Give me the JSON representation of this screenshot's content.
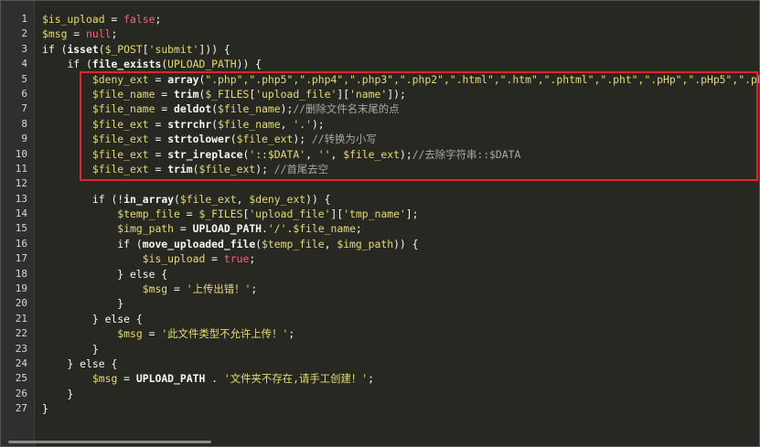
{
  "editor": {
    "line_numbers": [
      "1",
      "2",
      "3",
      "4",
      "5",
      "6",
      "7",
      "8",
      "9",
      "10",
      "11",
      "12",
      "13",
      "14",
      "15",
      "16",
      "17",
      "18",
      "19",
      "20",
      "21",
      "22",
      "23",
      "24",
      "25",
      "26",
      "27"
    ],
    "lines": [
      [
        {
          "t": "v",
          "x": "$is_upload"
        },
        {
          "t": "p",
          "x": " = "
        },
        {
          "t": "n",
          "x": "false"
        },
        {
          "t": "p",
          "x": ";"
        }
      ],
      [
        {
          "t": "v",
          "x": "$msg"
        },
        {
          "t": "p",
          "x": " = "
        },
        {
          "t": "n",
          "x": "null"
        },
        {
          "t": "p",
          "x": ";"
        }
      ],
      [
        {
          "t": "k",
          "x": "if"
        },
        {
          "t": "p",
          "x": " ("
        },
        {
          "t": "f",
          "x": "isset"
        },
        {
          "t": "p",
          "x": "("
        },
        {
          "t": "v",
          "x": "$_POST"
        },
        {
          "t": "p",
          "x": "["
        },
        {
          "t": "s",
          "x": "'submit'"
        },
        {
          "t": "p",
          "x": "])) {"
        }
      ],
      [
        {
          "t": "p",
          "x": "    "
        },
        {
          "t": "k",
          "x": "if"
        },
        {
          "t": "p",
          "x": " ("
        },
        {
          "t": "f",
          "x": "file_exists"
        },
        {
          "t": "p",
          "x": "("
        },
        {
          "t": "v",
          "x": "UPLOAD_PATH"
        },
        {
          "t": "p",
          "x": ")) {"
        }
      ],
      [
        {
          "t": "p",
          "x": "        "
        },
        {
          "t": "v",
          "x": "$deny_ext"
        },
        {
          "t": "p",
          "x": " = "
        },
        {
          "t": "f",
          "x": "array"
        },
        {
          "t": "p",
          "x": "("
        },
        {
          "t": "s",
          "x": "\".php\",\".php5\",\".php4\",\".php3\",\".php2\",\".html\",\".htm\",\".phtml\",\".pht\",\".pHp\",\".pHp5\",\".pHp4\",\".pHp3\",\".p"
        }
      ],
      [
        {
          "t": "p",
          "x": "        "
        },
        {
          "t": "v",
          "x": "$file_name"
        },
        {
          "t": "p",
          "x": " = "
        },
        {
          "t": "f",
          "x": "trim"
        },
        {
          "t": "p",
          "x": "("
        },
        {
          "t": "v",
          "x": "$_FILES"
        },
        {
          "t": "p",
          "x": "["
        },
        {
          "t": "s",
          "x": "'upload_file'"
        },
        {
          "t": "p",
          "x": "]["
        },
        {
          "t": "s",
          "x": "'name'"
        },
        {
          "t": "p",
          "x": "]);"
        }
      ],
      [
        {
          "t": "p",
          "x": "        "
        },
        {
          "t": "v",
          "x": "$file_name"
        },
        {
          "t": "p",
          "x": " = "
        },
        {
          "t": "f",
          "x": "deldot"
        },
        {
          "t": "p",
          "x": "("
        },
        {
          "t": "v",
          "x": "$file_name"
        },
        {
          "t": "p",
          "x": ");"
        },
        {
          "t": "c",
          "x": "//删除文件名末尾的点"
        }
      ],
      [
        {
          "t": "p",
          "x": "        "
        },
        {
          "t": "v",
          "x": "$file_ext"
        },
        {
          "t": "p",
          "x": " = "
        },
        {
          "t": "f",
          "x": "strrchr"
        },
        {
          "t": "p",
          "x": "("
        },
        {
          "t": "v",
          "x": "$file_name"
        },
        {
          "t": "p",
          "x": ", "
        },
        {
          "t": "s",
          "x": "'.'"
        },
        {
          "t": "p",
          "x": ");"
        }
      ],
      [
        {
          "t": "p",
          "x": "        "
        },
        {
          "t": "v",
          "x": "$file_ext"
        },
        {
          "t": "p",
          "x": " = "
        },
        {
          "t": "f",
          "x": "strtolower"
        },
        {
          "t": "p",
          "x": "("
        },
        {
          "t": "v",
          "x": "$file_ext"
        },
        {
          "t": "p",
          "x": "); "
        },
        {
          "t": "c",
          "x": "//转换为小写"
        }
      ],
      [
        {
          "t": "p",
          "x": "        "
        },
        {
          "t": "v",
          "x": "$file_ext"
        },
        {
          "t": "p",
          "x": " = "
        },
        {
          "t": "f",
          "x": "str_ireplace"
        },
        {
          "t": "p",
          "x": "("
        },
        {
          "t": "s",
          "x": "'::$DATA'"
        },
        {
          "t": "p",
          "x": ", "
        },
        {
          "t": "s",
          "x": "''"
        },
        {
          "t": "p",
          "x": ", "
        },
        {
          "t": "v",
          "x": "$file_ext"
        },
        {
          "t": "p",
          "x": ");"
        },
        {
          "t": "c",
          "x": "//去除字符串::$DATA"
        }
      ],
      [
        {
          "t": "p",
          "x": "        "
        },
        {
          "t": "v",
          "x": "$file_ext"
        },
        {
          "t": "p",
          "x": " = "
        },
        {
          "t": "f",
          "x": "trim"
        },
        {
          "t": "p",
          "x": "("
        },
        {
          "t": "v",
          "x": "$file_ext"
        },
        {
          "t": "p",
          "x": "); "
        },
        {
          "t": "c",
          "x": "//首尾去空"
        }
      ],
      [],
      [
        {
          "t": "p",
          "x": "        "
        },
        {
          "t": "k",
          "x": "if"
        },
        {
          "t": "p",
          "x": " (!"
        },
        {
          "t": "f",
          "x": "in_array"
        },
        {
          "t": "p",
          "x": "("
        },
        {
          "t": "v",
          "x": "$file_ext"
        },
        {
          "t": "p",
          "x": ", "
        },
        {
          "t": "v",
          "x": "$deny_ext"
        },
        {
          "t": "p",
          "x": ")) {"
        }
      ],
      [
        {
          "t": "p",
          "x": "            "
        },
        {
          "t": "v",
          "x": "$temp_file"
        },
        {
          "t": "p",
          "x": " = "
        },
        {
          "t": "v",
          "x": "$_FILES"
        },
        {
          "t": "p",
          "x": "["
        },
        {
          "t": "s",
          "x": "'upload_file'"
        },
        {
          "t": "p",
          "x": "]["
        },
        {
          "t": "s",
          "x": "'tmp_name'"
        },
        {
          "t": "p",
          "x": "];"
        }
      ],
      [
        {
          "t": "p",
          "x": "            "
        },
        {
          "t": "v",
          "x": "$img_path"
        },
        {
          "t": "p",
          "x": " = "
        },
        {
          "t": "f",
          "x": "UPLOAD_PATH"
        },
        {
          "t": "p",
          "x": "."
        },
        {
          "t": "s",
          "x": "'/'"
        },
        {
          "t": "p",
          "x": "."
        },
        {
          "t": "v",
          "x": "$file_name"
        },
        {
          "t": "p",
          "x": ";"
        }
      ],
      [
        {
          "t": "p",
          "x": "            "
        },
        {
          "t": "k",
          "x": "if"
        },
        {
          "t": "p",
          "x": " ("
        },
        {
          "t": "f",
          "x": "move_uploaded_file"
        },
        {
          "t": "p",
          "x": "("
        },
        {
          "t": "v",
          "x": "$temp_file"
        },
        {
          "t": "p",
          "x": ", "
        },
        {
          "t": "v",
          "x": "$img_path"
        },
        {
          "t": "p",
          "x": ")) {"
        }
      ],
      [
        {
          "t": "p",
          "x": "                "
        },
        {
          "t": "v",
          "x": "$is_upload"
        },
        {
          "t": "p",
          "x": " = "
        },
        {
          "t": "n",
          "x": "true"
        },
        {
          "t": "p",
          "x": ";"
        }
      ],
      [
        {
          "t": "p",
          "x": "            } "
        },
        {
          "t": "k",
          "x": "else"
        },
        {
          "t": "p",
          "x": " {"
        }
      ],
      [
        {
          "t": "p",
          "x": "                "
        },
        {
          "t": "v",
          "x": "$msg"
        },
        {
          "t": "p",
          "x": " = "
        },
        {
          "t": "s",
          "x": "'上传出错！'"
        },
        {
          "t": "p",
          "x": ";"
        }
      ],
      [
        {
          "t": "p",
          "x": "            }"
        }
      ],
      [
        {
          "t": "p",
          "x": "        } "
        },
        {
          "t": "k",
          "x": "else"
        },
        {
          "t": "p",
          "x": " {"
        }
      ],
      [
        {
          "t": "p",
          "x": "            "
        },
        {
          "t": "v",
          "x": "$msg"
        },
        {
          "t": "p",
          "x": " = "
        },
        {
          "t": "s",
          "x": "'此文件类型不允许上传！'"
        },
        {
          "t": "p",
          "x": ";"
        }
      ],
      [
        {
          "t": "p",
          "x": "        }"
        }
      ],
      [
        {
          "t": "p",
          "x": "    } "
        },
        {
          "t": "k",
          "x": "else"
        },
        {
          "t": "p",
          "x": " {"
        }
      ],
      [
        {
          "t": "p",
          "x": "        "
        },
        {
          "t": "v",
          "x": "$msg"
        },
        {
          "t": "p",
          "x": " = "
        },
        {
          "t": "f",
          "x": "UPLOAD_PATH"
        },
        {
          "t": "p",
          "x": " . "
        },
        {
          "t": "s",
          "x": "'文件夹不存在,请手工创建！'"
        },
        {
          "t": "p",
          "x": ";"
        }
      ],
      [
        {
          "t": "p",
          "x": "    }"
        }
      ],
      [
        {
          "t": "p",
          "x": "}"
        }
      ]
    ]
  }
}
